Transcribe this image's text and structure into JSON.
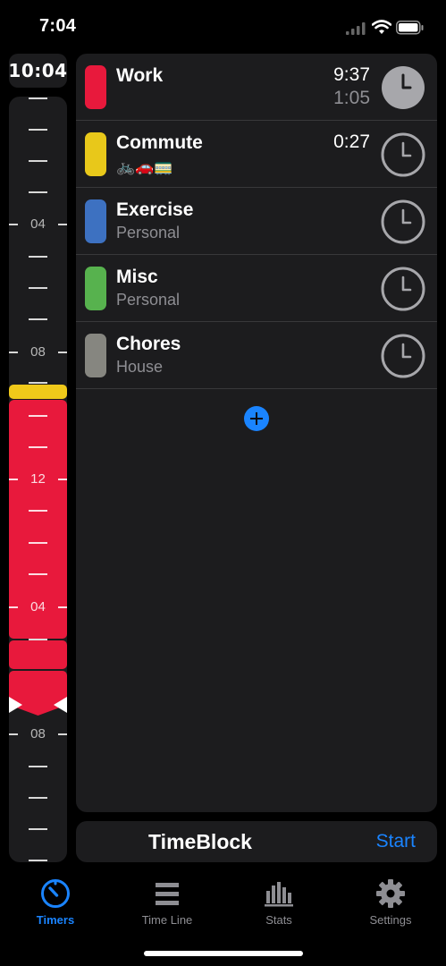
{
  "status_bar": {
    "time": "7:04",
    "wifi_icon": "wifi-icon",
    "battery_icon": "battery-icon",
    "signal_icon": "cellular-signal-icon"
  },
  "timeline": {
    "current_time": "10:04",
    "hour_labels": [
      "04",
      "08",
      "12",
      "04",
      "08"
    ]
  },
  "tasks": [
    {
      "name": "Work",
      "subtitle": "",
      "time": "9:37",
      "elapsed": "1:05",
      "color": "#e8193c",
      "active": true
    },
    {
      "name": "Commute",
      "subtitle": "🚲🚗🚃",
      "time": "0:27",
      "elapsed": "",
      "color": "#e8c81a",
      "active": false
    },
    {
      "name": "Exercise",
      "subtitle": "Personal",
      "time": "",
      "elapsed": "",
      "color": "#3d71c1",
      "active": false
    },
    {
      "name": "Misc",
      "subtitle": "Personal",
      "time": "",
      "elapsed": "",
      "color": "#57b24e",
      "active": false
    },
    {
      "name": "Chores",
      "subtitle": "House",
      "time": "",
      "elapsed": "",
      "color": "#868680",
      "active": false
    }
  ],
  "add_button_icon": "plus-circle-icon",
  "bottom_bar": {
    "title": "TimeBlock",
    "start_label": "Start"
  },
  "tabs": [
    {
      "label": "Timers",
      "icon": "timer-icon",
      "active": true
    },
    {
      "label": "Time Line",
      "icon": "list-icon",
      "active": false
    },
    {
      "label": "Stats",
      "icon": "bar-chart-icon",
      "active": false
    },
    {
      "label": "Settings",
      "icon": "gear-icon",
      "active": false
    }
  ],
  "colors": {
    "accent": "#1a84ff",
    "panel": "#1c1c1e",
    "background": "#000000"
  }
}
